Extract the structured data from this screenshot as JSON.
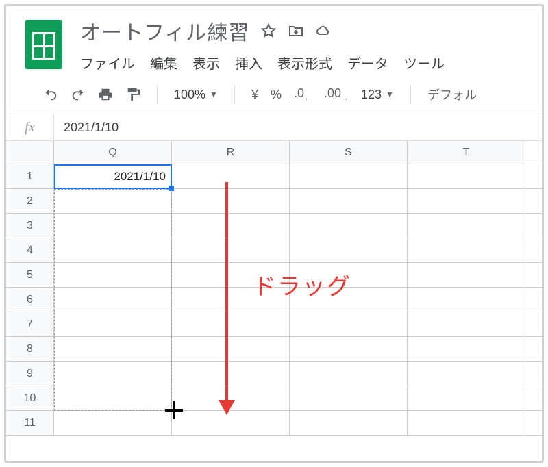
{
  "doc": {
    "title": "オートフィル練習"
  },
  "menus": {
    "file": "ファイル",
    "edit": "編集",
    "view": "表示",
    "insert": "挿入",
    "format": "表示形式",
    "data": "データ",
    "tools": "ツール"
  },
  "toolbar": {
    "zoom": "100%",
    "currency": "¥",
    "percent": "%",
    "dec_less": ".0",
    "dec_more": ".00",
    "numfmt": "123",
    "font_trunc": "デフォル"
  },
  "formula_bar": {
    "label": "fx",
    "value": "2021/1/10"
  },
  "columns": [
    "Q",
    "R",
    "S",
    "T"
  ],
  "row_numbers": [
    "1",
    "2",
    "3",
    "4",
    "5",
    "6",
    "7",
    "8",
    "9",
    "10",
    "11"
  ],
  "cells": {
    "Q1": "2021/1/10"
  },
  "annotation": {
    "drag_label": "ドラッグ"
  },
  "colors": {
    "brand_green": "#0f9d58",
    "selection_blue": "#1a73e8",
    "annotation_red": "#e53935"
  }
}
